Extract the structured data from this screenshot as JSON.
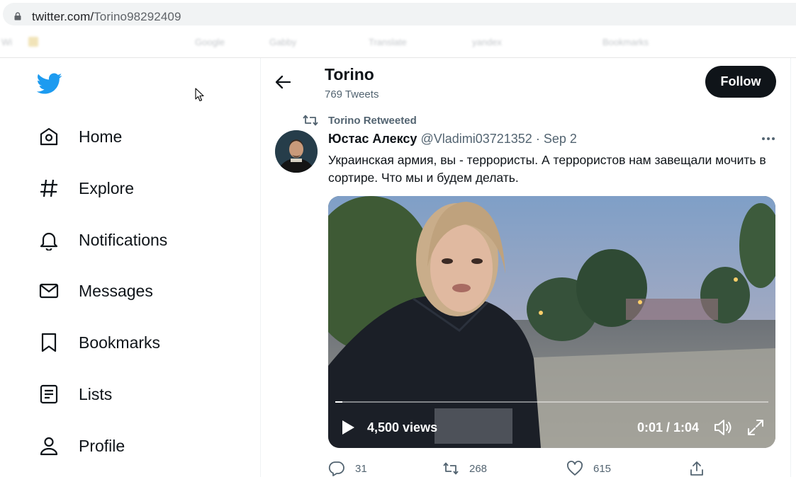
{
  "browser": {
    "url_domain": "twitter.com/",
    "url_path": "Torino98292409",
    "bookmarks": [
      "Wi",
      "Google",
      "Gabby",
      "Translate",
      "yandex",
      "Bookmarks"
    ]
  },
  "nav": {
    "items": [
      {
        "label": "Home",
        "icon": "home-icon"
      },
      {
        "label": "Explore",
        "icon": "hashtag-icon"
      },
      {
        "label": "Notifications",
        "icon": "bell-icon"
      },
      {
        "label": "Messages",
        "icon": "envelope-icon"
      },
      {
        "label": "Bookmarks",
        "icon": "bookmark-icon"
      },
      {
        "label": "Lists",
        "icon": "list-icon"
      },
      {
        "label": "Profile",
        "icon": "person-icon"
      }
    ]
  },
  "profile": {
    "name": "Torino",
    "tweet_count": "769 Tweets",
    "follow_label": "Follow"
  },
  "tweet": {
    "retweeted_by": "Torino Retweeted",
    "author_name": "Юстас Алексу",
    "author_handle": "@Vladimi03721352",
    "separator": "·",
    "date": "Sep 2",
    "text": "Украинская армия, вы - террористы. А террористов нам завещали мочить в сортире. Что мы и будем делать.",
    "video": {
      "views": "4,500 views",
      "time": "0:01 / 1:04",
      "progress": 0.016
    },
    "actions": {
      "replies": "31",
      "retweets": "268",
      "likes": "615"
    }
  },
  "colors": {
    "brand": "#1d9bf0",
    "text": "#0f1419",
    "secondary": "#536471",
    "follow_bg": "#0f1419"
  }
}
